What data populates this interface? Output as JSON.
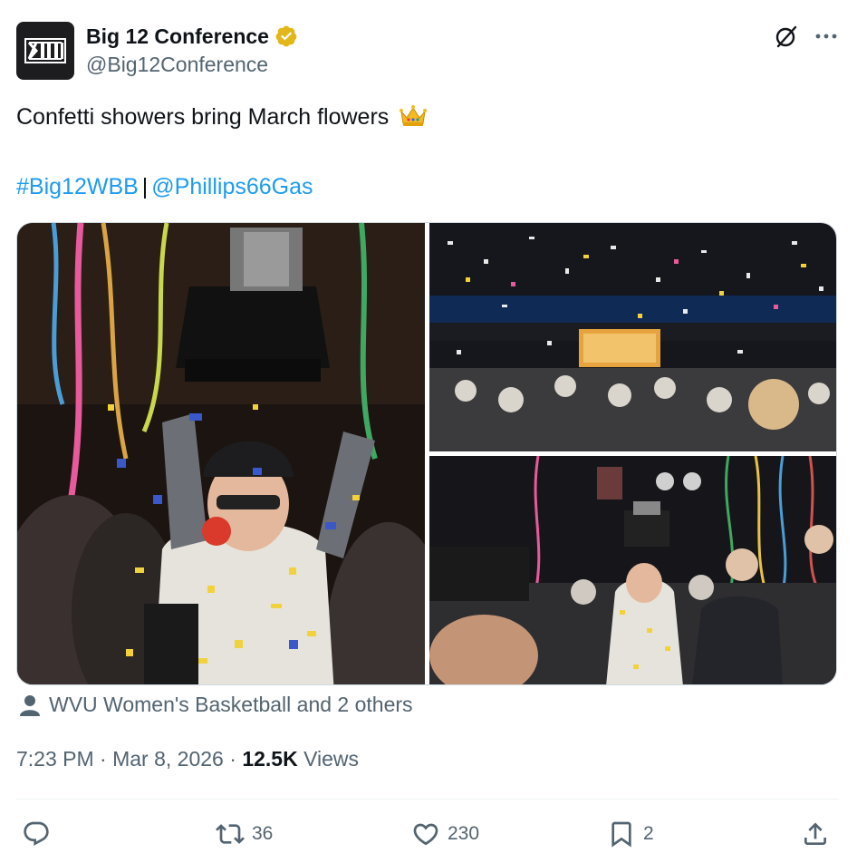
{
  "author": {
    "display_name": "Big 12 Conference",
    "handle": "@Big12Conference",
    "avatar_icon": "big12-logo",
    "verified_badge": "gold-verified-icon",
    "avatar_bg": "#1d1d1f"
  },
  "header_actions": {
    "grok_icon": "grok-icon",
    "more_icon": "more-icon"
  },
  "tweet": {
    "text": "Confetti showers bring March flowers",
    "emoji_icon": "crown-icon",
    "hashtag": "#Big12WBB",
    "separator": "|",
    "mention": "@Phillips66Gas",
    "link_color": "#1d9bf0"
  },
  "media": {
    "images": [
      {
        "name": "coach-holding-trophy"
      },
      {
        "name": "champions-confetti-crowd"
      },
      {
        "name": "trophy-raise-celebration"
      }
    ]
  },
  "tagged": {
    "icon": "person-icon",
    "text": "WVU Women's Basketball and 2 others"
  },
  "meta": {
    "time": "7:23 PM",
    "dot1": "·",
    "date": "Mar 8, 2026",
    "dot2": "·",
    "views_count": "12.5K",
    "views_label": "Views"
  },
  "actions": {
    "reply": {
      "icon": "reply-icon",
      "count": ""
    },
    "retweet": {
      "icon": "retweet-icon",
      "count": "36"
    },
    "like": {
      "icon": "heart-icon",
      "count": "230"
    },
    "bookmark": {
      "icon": "bookmark-icon",
      "count": "2"
    },
    "share": {
      "icon": "share-icon",
      "count": ""
    }
  },
  "colors": {
    "text_primary": "#0f1419",
    "text_secondary": "#536471",
    "divider": "#eff3f4"
  }
}
